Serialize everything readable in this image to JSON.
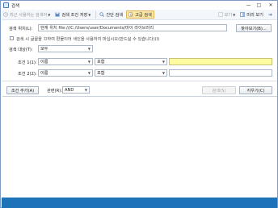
{
  "window": {
    "title": "검색",
    "minimize_glyph": "—",
    "maximize_glyph": "□",
    "close_glyph": "✕"
  },
  "toolbar": {
    "recent_label": "최근 사용하는 검색어",
    "save_label": "검색 조건 저장",
    "simple_label": "간단 검색",
    "advanced_label": "고급 검색",
    "view_label": "보기",
    "preview_label": "미리 보기",
    "pin_glyph": "➔"
  },
  "form": {
    "location_label": "검색 위치(L):",
    "location_value": "현재 위치 file:///C:/Users/user/Documents/마이 라이브러리",
    "browse_label": "찾아보기(B)...",
    "index_checkbox_label": "검색 시 글꼴을 끄하여 편물이어 색인을 사용하지 마십시오(만드실 수 있습니다)(I)",
    "target_label": "검색 대상(T):",
    "target_value": "모두",
    "cond1_label": "조건 1(1):",
    "cond1_field": "이름",
    "cond1_op": "포함",
    "cond1_value": "",
    "cond2_label": "조건 2(2):",
    "cond2_field": "이름",
    "cond2_op": "포함",
    "cond2_value": "",
    "add_cond_label": "조건 추가(A)",
    "relation_label": "관련(R):",
    "relation_value": "AND",
    "search_label": "검색(S)",
    "clear_label": "지우기(C)"
  }
}
